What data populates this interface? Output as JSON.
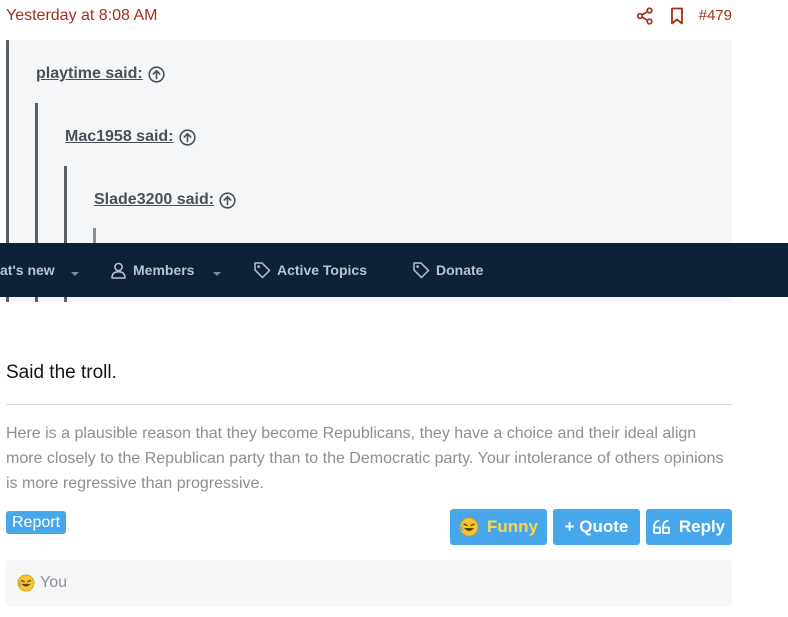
{
  "post": {
    "date": "Yesterday at 8:08 AM",
    "number": "#479",
    "share_icon": "share-icon",
    "bookmark_icon": "bookmark-icon"
  },
  "quotes": [
    {
      "author": "playtime said:"
    },
    {
      "author": "Mac1958 said:"
    },
    {
      "author": "Slade3200 said:"
    }
  ],
  "nav": {
    "items": [
      {
        "label": "at's new",
        "icon": ""
      },
      {
        "label": "Members",
        "icon": "user-icon"
      },
      {
        "label": "Active Topics",
        "icon": "tag-icon"
      },
      {
        "label": "Donate",
        "icon": "tag-icon"
      }
    ]
  },
  "body": {
    "text": "Said the troll.",
    "signature": "Here is a plausible reason that they become Republicans, they have a choice and their ideal align more closely to the Republican party than to the Democratic party. Your intolerance of others opinions is more regressive than progressive."
  },
  "actions": {
    "report": "Report",
    "funny": "Funny",
    "quote": "+ Quote",
    "reply": "Reply"
  },
  "reactions": {
    "text": "You",
    "emoji": "laughing-emoji"
  },
  "colors": {
    "accent": "#a4301c",
    "button": "#47a7eb",
    "nav_bg": "#0f2136",
    "funny_text": "#fbd64a"
  }
}
